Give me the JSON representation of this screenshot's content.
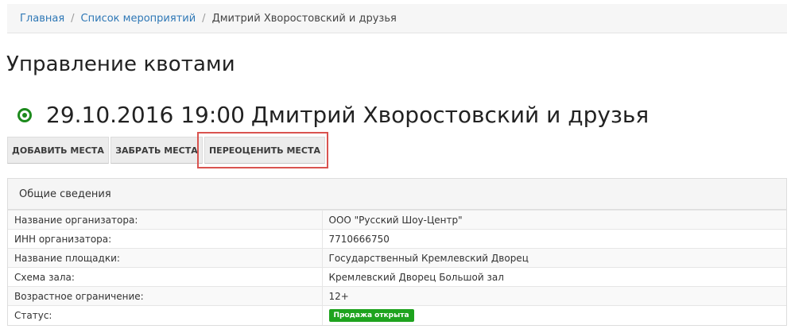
{
  "breadcrumb": {
    "items": [
      "Главная",
      "Список мероприятий"
    ],
    "current": "Дмитрий Хворостовский и друзья"
  },
  "page": {
    "title": "Управление квотами"
  },
  "event": {
    "datetime": "29.10.2016 19:00",
    "name": "Дмитрий Хворостовский и друзья",
    "status_icon": "radio-on-icon",
    "status_icon_color": "#1d8a1d"
  },
  "toolbar": {
    "add_label": "ДОБАВИТЬ МЕСТА",
    "take_label": "ЗАБРАТЬ МЕСТА",
    "reprice_label": "ПЕРЕОЦЕНИТЬ МЕСТА",
    "highlight_color": "#d9534f"
  },
  "info_panel": {
    "heading": "Общие сведения",
    "rows": [
      {
        "label": "Название организатора:",
        "value": "ООО \"Русский Шоу-Центр\""
      },
      {
        "label": "ИНН организатора:",
        "value": "7710666750"
      },
      {
        "label": "Название площадки:",
        "value": "Государственный Кремлевский Дворец"
      },
      {
        "label": "Схема зала:",
        "value": "Кремлевский Дворец Большой зал"
      },
      {
        "label": "Возрастное ограничение:",
        "value": "12+"
      },
      {
        "label": "Статус:",
        "value": "Продажа открыта",
        "badge_color": "#1ea31e"
      }
    ]
  }
}
